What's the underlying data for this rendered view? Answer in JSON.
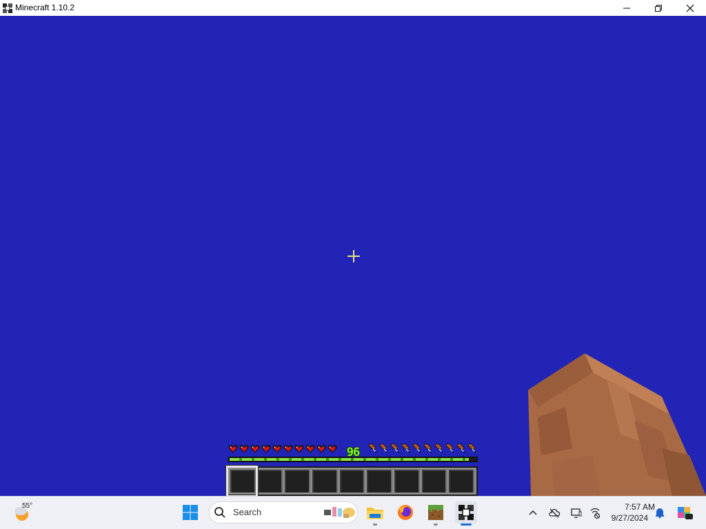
{
  "window": {
    "title": "Minecraft 1.10.2",
    "controls": [
      "minimize",
      "maximize",
      "close"
    ]
  },
  "hud": {
    "hearts": 10,
    "hunger": 10,
    "xp_level": "96",
    "xp_progress": 0.97,
    "hotbar_slots": 9,
    "selected_slot": 1
  },
  "sky_color": "#2124b4",
  "taskbar": {
    "weather_temp": "55°",
    "search_placeholder": "Search",
    "apps": [
      "start-icon",
      "file-explorer-icon",
      "firefox-icon",
      "minecraft-launcher-icon",
      "minecraft-icon"
    ],
    "clock": {
      "time": "7:57 AM",
      "date": "9/27/2024"
    }
  }
}
